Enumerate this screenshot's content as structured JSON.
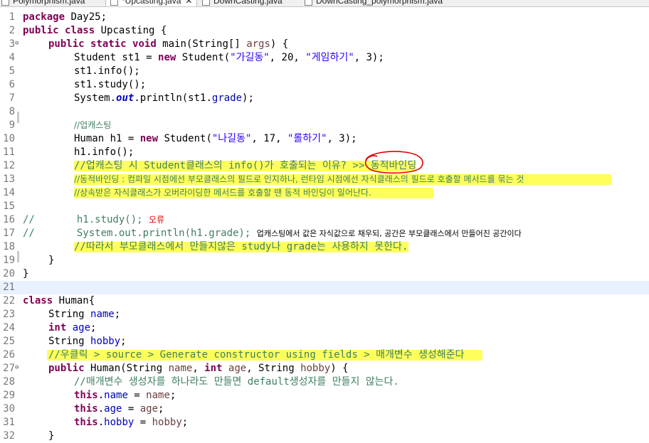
{
  "tabs": [
    {
      "label": "Polymorphism.java",
      "active": false
    },
    {
      "label": "*Upcasting.java",
      "active": true
    },
    {
      "label": "DownCasting.java",
      "active": false
    },
    {
      "label": "DownCasting_polymorphism.java",
      "active": false
    }
  ],
  "lines": [
    {
      "n": "1"
    },
    {
      "n": "2"
    },
    {
      "n": "3"
    },
    {
      "n": "4"
    },
    {
      "n": "5"
    },
    {
      "n": "6"
    },
    {
      "n": "7"
    },
    {
      "n": "8"
    },
    {
      "n": "9"
    },
    {
      "n": "10"
    },
    {
      "n": "11"
    },
    {
      "n": "12"
    },
    {
      "n": "13"
    },
    {
      "n": "14"
    },
    {
      "n": "15"
    },
    {
      "n": "16"
    },
    {
      "n": "17"
    },
    {
      "n": "18"
    },
    {
      "n": "19"
    },
    {
      "n": "20"
    },
    {
      "n": "21"
    },
    {
      "n": "22"
    },
    {
      "n": "23"
    },
    {
      "n": "24"
    },
    {
      "n": "25"
    },
    {
      "n": "26"
    },
    {
      "n": "27"
    },
    {
      "n": "28"
    },
    {
      "n": "29"
    },
    {
      "n": "30"
    },
    {
      "n": "31"
    },
    {
      "n": "32"
    }
  ],
  "code": {
    "l1": {
      "kw": "package",
      "rest": " Day25;"
    },
    "l2": {
      "kw1": "public",
      "kw2": "class",
      "rest": " Upcasting {"
    },
    "l3": {
      "kw1": "public",
      "kw2": "static",
      "kw3": "void",
      "a": " main(String[] ",
      "p": "args",
      "b": ") {"
    },
    "l4": {
      "a": "Student st1 = ",
      "kw": "new",
      "b": " Student(",
      "s1": "\"가길동\"",
      "c": ", 20, ",
      "s2": "\"게임하기\"",
      "d": ", 3);"
    },
    "l5": {
      "a": "st1.info();"
    },
    "l6": {
      "a": "st1.study();"
    },
    "l7": {
      "a": "System.",
      "sf": "out",
      "b": ".println(st1.",
      "f": "grade",
      "c": ");"
    },
    "l9": {
      "cm": "//업캐스팅"
    },
    "l10": {
      "a": "Human h1 = ",
      "kw": "new",
      "b": " Student(",
      "s1": "\"나길동\"",
      "c": ", 17, ",
      "s2": "\"롤하기\"",
      "d": ", 3);"
    },
    "l11": {
      "a": "h1.info();"
    },
    "l12": {
      "cm": "//업캐스팅 시 Student클래스의 info()가 호출되는 이유? >> 동적바인딩"
    },
    "l13": {
      "cm": "//동적바인딩 : 컴파일 시점에선 부모클래스의 필드로 인지하나, 런타임 시점에선 자식클래스의 필드로 호출할 메서드를 묶는 것"
    },
    "l14": {
      "cm": "//상속받은 자식클래스가 오버라이딩한 메서드를 호출할 땐 동적 바인딩이 일어난다."
    },
    "l16": {
      "cm": "//",
      "a": "       h1.study(); ",
      "red": "오류"
    },
    "l17": {
      "cm": "//",
      "a": "       System.out.println(h1.grade); ",
      "k": "업캐스팅에서 값은 자식값으로 채우되, 공간은 부모클래스에서 만들어진 공간이다"
    },
    "l18": {
      "cm": "//따라서 부모클래스에서 만들지않은 study나 grade는 사용하지 못한다."
    },
    "l19": {
      "a": "}"
    },
    "l20": {
      "a": "}"
    },
    "l22": {
      "kw": "class",
      "a": " Human{"
    },
    "l23": {
      "a": "String ",
      "f": "name",
      "b": ";"
    },
    "l24": {
      "kw": "int",
      "a": " ",
      "f": "age",
      "b": ";"
    },
    "l25": {
      "a": "String ",
      "f": "hobby",
      "b": ";"
    },
    "l26": {
      "cm": "//우클릭 > source > Generate constructor using fields > 매개변수 생성해준다"
    },
    "l27": {
      "kw1": "public",
      "a": " Human(String ",
      "p1": "name",
      "b": ", ",
      "kw2": "int",
      "c": " ",
      "p2": "age",
      "d": ", String ",
      "p3": "hobby",
      "e": ") {"
    },
    "l28": {
      "cm": "//매개변수 생성자를 하나라도 만들면 default생성자를 만들지 않는다."
    },
    "l29": {
      "kw": "this",
      "a": ".",
      "f": "name",
      "b": " = ",
      "p": "name",
      "c": ";"
    },
    "l30": {
      "kw": "this",
      "a": ".",
      "f": "age",
      "b": " = ",
      "p": "age",
      "c": ";"
    },
    "l31": {
      "kw": "this",
      "a": ".",
      "f": "hobby",
      "b": " = ",
      "p": "hobby",
      "c": ";"
    },
    "l32": {
      "a": "}"
    }
  },
  "colors": {
    "keyword": "#7f0055",
    "string": "#2a00ff",
    "comment": "#3f7f5f",
    "field": "#0000c0",
    "highlight": "#ffff24",
    "annotation": "#e00000"
  }
}
